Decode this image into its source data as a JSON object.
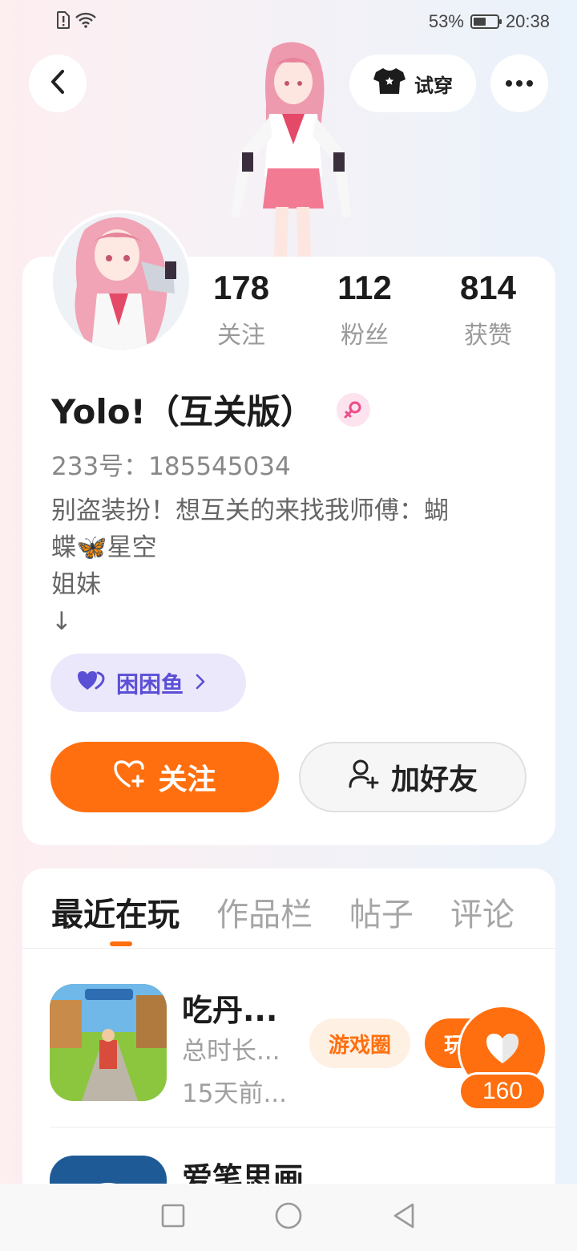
{
  "status_bar": {
    "battery_percent": "53%",
    "battery_level": 0.53,
    "time": "20:38",
    "icons": [
      "sim-alert-icon",
      "wifi-icon",
      "battery-icon"
    ]
  },
  "header": {
    "back_icon": "chevron-left-icon",
    "tryon_label": "试穿",
    "tryon_icon": "shirt-icon",
    "more_icon": "more-dots-icon"
  },
  "profile": {
    "stats": [
      {
        "value": "178",
        "label": "关注"
      },
      {
        "value": "112",
        "label": "粉丝"
      },
      {
        "value": "814",
        "label": "获赞"
      }
    ],
    "nickname": "Yolo!（互关版）",
    "gender_icon": "female-icon",
    "uid": "233号：185545034",
    "bio": [
      "别盗装扮！想互关的来找我师傅：蝴",
      "蝶🦋星空",
      "姐妹",
      "↓"
    ],
    "guild_label": "困困鱼",
    "follow_label": "关注",
    "add_friend_label": "加好友"
  },
  "tabs": [
    {
      "label": "最近在玩",
      "active": true
    },
    {
      "label": "作品栏",
      "active": false
    },
    {
      "label": "帖子",
      "active": false
    },
    {
      "label": "评论",
      "active": false
    }
  ],
  "recent_games": [
    {
      "title": "吃丹...",
      "playtime": "总时长...",
      "last_played": "15天前...",
      "circle_label": "游戏圈",
      "play_label": "玩"
    },
    {
      "title": "爱笔思画"
    }
  ],
  "floating_like": {
    "count": "160",
    "icon": "heart-icon"
  },
  "colors": {
    "accent": "#ff6f0f",
    "guild": "#5b4fd6",
    "guild_bg": "#ebe8fb"
  }
}
